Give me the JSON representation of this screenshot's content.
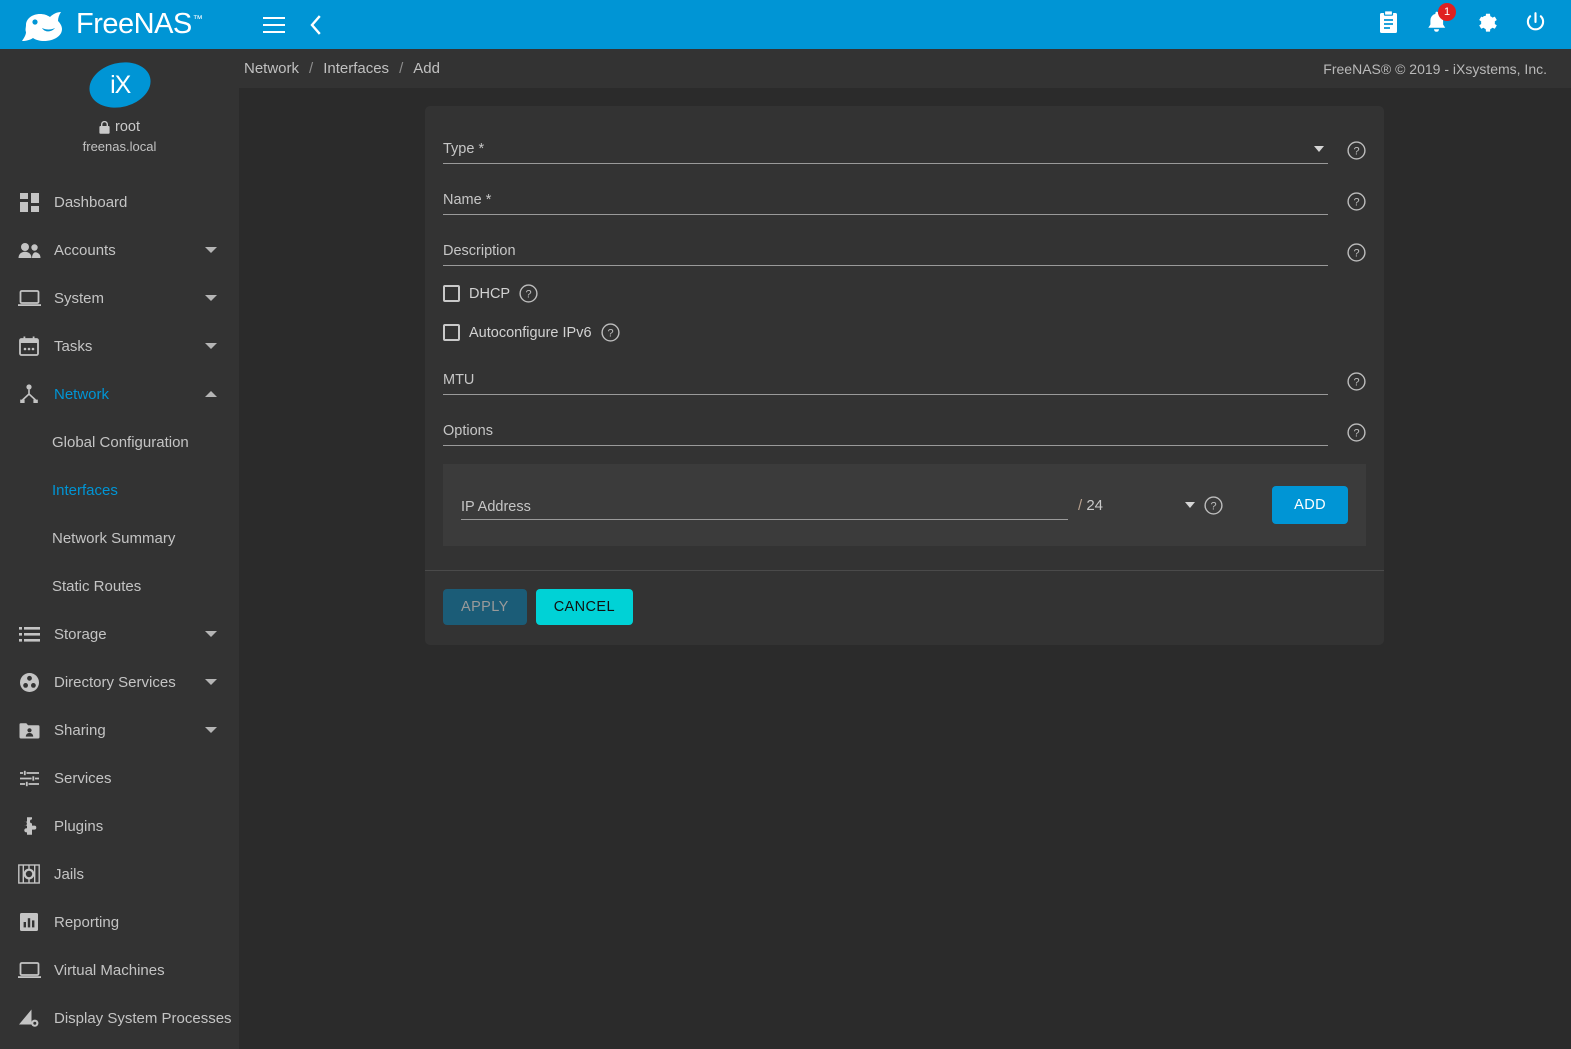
{
  "brand": {
    "name": "FreeNAS",
    "trademark": "™",
    "logo_icon": "freenas-fish-logo"
  },
  "user": {
    "avatar_text": "iX",
    "lock_icon": "lock-icon",
    "username": "root",
    "hostname": "freenas.local"
  },
  "sidebar": {
    "items": [
      {
        "label": "Dashboard",
        "icon": "dashboard-icon",
        "expandable": false,
        "active": false
      },
      {
        "label": "Accounts",
        "icon": "accounts-icon",
        "expandable": true,
        "active": false
      },
      {
        "label": "System",
        "icon": "system-icon",
        "expandable": true,
        "active": false
      },
      {
        "label": "Tasks",
        "icon": "tasks-icon",
        "expandable": true,
        "active": false
      },
      {
        "label": "Network",
        "icon": "network-icon",
        "expandable": true,
        "active": true,
        "expanded": true
      },
      {
        "label": "Storage",
        "icon": "storage-icon",
        "expandable": true,
        "active": false
      },
      {
        "label": "Directory Services",
        "icon": "directory-services-icon",
        "expandable": true,
        "active": false
      },
      {
        "label": "Sharing",
        "icon": "sharing-icon",
        "expandable": true,
        "active": false
      },
      {
        "label": "Services",
        "icon": "services-icon",
        "expandable": false,
        "active": false
      },
      {
        "label": "Plugins",
        "icon": "plugins-icon",
        "expandable": false,
        "active": false
      },
      {
        "label": "Jails",
        "icon": "jails-icon",
        "expandable": false,
        "active": false
      },
      {
        "label": "Reporting",
        "icon": "reporting-icon",
        "expandable": false,
        "active": false
      },
      {
        "label": "Virtual Machines",
        "icon": "virtual-machines-icon",
        "expandable": false,
        "active": false
      },
      {
        "label": "Display System Processes",
        "icon": "display-system-processes-icon",
        "expandable": false,
        "active": false
      }
    ],
    "network_subitems": [
      {
        "label": "Global Configuration",
        "active": false
      },
      {
        "label": "Interfaces",
        "active": true
      },
      {
        "label": "Network Summary",
        "active": false
      },
      {
        "label": "Static Routes",
        "active": false
      }
    ]
  },
  "topbar": {
    "menu_icon": "hamburger-menu-icon",
    "back_icon": "chevron-left-icon",
    "icons": [
      {
        "name": "clipboard-tasks-icon",
        "badge": null
      },
      {
        "name": "notifications-bell-icon",
        "badge": "1"
      },
      {
        "name": "settings-gear-icon",
        "badge": null
      },
      {
        "name": "power-icon",
        "badge": null
      }
    ],
    "accent_color": "#0095d5",
    "badge_color": "#e02020"
  },
  "breadcrumb": {
    "separator": "/",
    "items": [
      "Network",
      "Interfaces",
      "Add"
    ]
  },
  "copyright": "FreeNAS® © 2019 - iXsystems, Inc.",
  "form": {
    "fields": [
      {
        "label": "Type",
        "required": true,
        "value": "",
        "type": "select",
        "help_icon": "help-circle-icon"
      },
      {
        "label": "Name",
        "required": true,
        "value": "",
        "type": "text",
        "help_icon": "help-circle-icon"
      },
      {
        "label": "Description",
        "required": false,
        "value": "",
        "type": "text",
        "help_icon": "help-circle-icon"
      }
    ],
    "checkboxes": [
      {
        "label": "DHCP",
        "checked": false,
        "help_icon": "help-circle-icon"
      },
      {
        "label": "Autoconfigure IPv6",
        "checked": false,
        "help_icon": "help-circle-icon"
      }
    ],
    "fields2": [
      {
        "label": "MTU",
        "required": false,
        "value": "",
        "type": "text",
        "help_icon": "help-circle-icon"
      },
      {
        "label": "Options",
        "required": false,
        "value": "",
        "type": "text",
        "help_icon": "help-circle-icon"
      }
    ],
    "ip_row": {
      "address_label": "IP Address",
      "address_value": "",
      "netmask_slash": "/",
      "netmask_value": "24",
      "netmask_caret_icon": "chevron-down-icon",
      "help_icon": "help-circle-icon",
      "add_label": "ADD"
    },
    "actions": {
      "apply_label": "APPLY",
      "apply_disabled": true,
      "apply_color": "#1b5c77",
      "cancel_label": "CANCEL",
      "cancel_color": "#00d2d6"
    },
    "required_marker": "*"
  }
}
